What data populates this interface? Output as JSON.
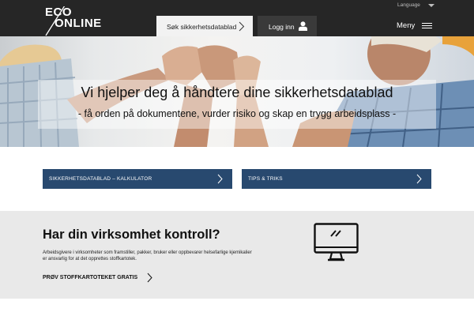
{
  "header": {
    "logo_line1": "ECO",
    "logo_line2": "ONLINE",
    "language_label": "Language",
    "search_tab_label": "Søk sikkerhetsdatablad",
    "login_label": "Logg inn",
    "menu_label": "Meny",
    "colors": {
      "background": "#262626",
      "search_tab": "#f2f2f2",
      "login_tab": "#3a3a3a"
    }
  },
  "hero": {
    "title": "Vi hjelper deg å håndtere dine sikkerhetsdatablad",
    "subtitle": "- få orden på dokumentene, vurder risiko og skap en trygg arbeidsplass -"
  },
  "buttons": {
    "calculator_label": "SIKKERHETSDATABLAD – KALKULATOR",
    "tips_label": "TIPS & TRIKS",
    "color": "#28496f"
  },
  "promo": {
    "title": "Har din virksomhet kontroll?",
    "body": "Arbeidsgivere i virksomheter som framstiller, pakker, bruker eller oppbevarer helsefarlige kjemikalier er ansvarlig for at det opprettes stoffkartotek.",
    "link_label": "PRØV STOFFKARTOTEKET GRATIS",
    "icon": "monitor-icon",
    "background": "#e9e9e9"
  }
}
